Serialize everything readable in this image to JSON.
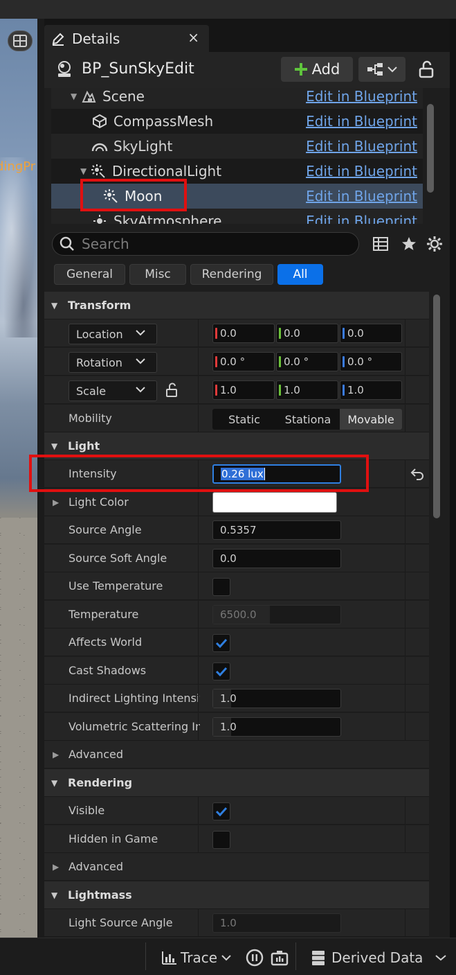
{
  "viewport": {
    "clipped_text": "dingPr"
  },
  "panel": {
    "tab_label": "Details",
    "tab_close": "×",
    "blueprint_name": "BP_SunSkyEdit",
    "add_label": "Add"
  },
  "tree": {
    "items": [
      {
        "label": "Scene",
        "link": "Edit in Blueprint",
        "icon": "scene-icon"
      },
      {
        "label": "CompassMesh",
        "link": "Edit in Blueprint",
        "icon": "static-mesh-icon"
      },
      {
        "label": "SkyLight",
        "link": "Edit in Blueprint",
        "icon": "skylight-icon"
      },
      {
        "label": "DirectionalLight",
        "link": "Edit in Blueprint",
        "icon": "directional-light-icon"
      },
      {
        "label": "Moon",
        "link": "Edit in Blueprint",
        "icon": "directional-light-icon",
        "selected": true
      },
      {
        "label": "SkyAtmosphere",
        "link": "Edit in Blueprint",
        "icon": "sky-atmosphere-icon"
      }
    ]
  },
  "search": {
    "placeholder": "Search"
  },
  "filters": [
    "General",
    "Misc",
    "Rendering",
    "All"
  ],
  "active_filter": "All",
  "colors": {
    "accent": "#0b70e8",
    "link": "#6fa4e8",
    "highlight": "#e01010",
    "axis_x": "#e03a3a",
    "axis_y": "#6cc33a",
    "axis_z": "#3a7be0"
  },
  "transform": {
    "section": "Transform",
    "location": {
      "label": "Location",
      "x": "0.0",
      "y": "0.0",
      "z": "0.0"
    },
    "rotation": {
      "label": "Rotation",
      "x": "0.0 °",
      "y": "0.0 °",
      "z": "0.0 °"
    },
    "scale": {
      "label": "Scale",
      "x": "1.0",
      "y": "1.0",
      "z": "1.0"
    },
    "mobility": {
      "label": "Mobility",
      "options": [
        "Static",
        "Stationa",
        "Movable"
      ],
      "selected": "Movable"
    }
  },
  "light": {
    "section": "Light",
    "intensity": {
      "label": "Intensity",
      "value": "0.26 lux"
    },
    "light_color": {
      "label": "Light Color",
      "value": "#ffffff"
    },
    "source_angle": {
      "label": "Source Angle",
      "value": "0.5357"
    },
    "source_soft_angle": {
      "label": "Source Soft Angle",
      "value": "0.0"
    },
    "use_temperature": {
      "label": "Use Temperature",
      "checked": false
    },
    "temperature": {
      "label": "Temperature",
      "value": "6500.0"
    },
    "affects_world": {
      "label": "Affects World",
      "checked": true
    },
    "cast_shadows": {
      "label": "Cast Shadows",
      "checked": true
    },
    "indirect_lighting": {
      "label": "Indirect Lighting Intensity",
      "value": "1.0"
    },
    "volumetric": {
      "label": "Volumetric Scattering In...",
      "value": "1.0"
    },
    "advanced": "Advanced"
  },
  "rendering": {
    "section": "Rendering",
    "visible": {
      "label": "Visible",
      "checked": true
    },
    "hidden_in_game": {
      "label": "Hidden in Game",
      "checked": false
    },
    "advanced": "Advanced"
  },
  "lightmass": {
    "section": "Lightmass",
    "light_source_angle": {
      "label": "Light Source Angle",
      "value": "1.0"
    }
  },
  "bottombar": {
    "trace": "Trace",
    "derived_data": "Derived Data"
  }
}
